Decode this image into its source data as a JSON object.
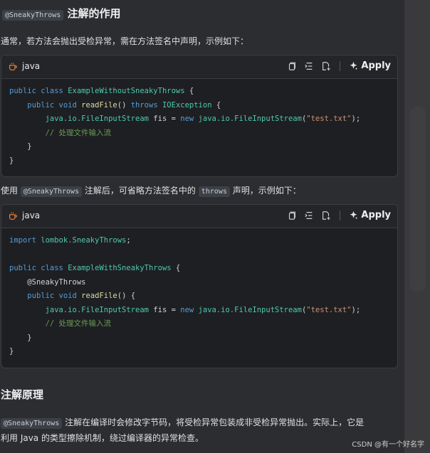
{
  "section1": {
    "badge": "@SneakyThrows",
    "title": "注解的作用",
    "intro": "通常，若方法会抛出受检异常，需在方法签名中声明，示例如下："
  },
  "codeblock1": {
    "lang": "java",
    "apply_label": "Apply",
    "lines": [
      [
        "public class ExampleWithoutSneakyThrows {"
      ],
      [
        "    public void readFile() throws IOException {"
      ],
      [
        "        java.io.FileInputStream fis = new java.io.FileInputStream(\"test.txt\");"
      ],
      [
        "        // 处理文件输入流"
      ],
      [
        "    }"
      ],
      [
        "}"
      ]
    ]
  },
  "mid": {
    "part1": "使用 ",
    "badge1": "@SneakyThrows",
    "part2": " 注解后，可省略方法签名中的 ",
    "badge2": "throws",
    "part3": " 声明，示例如下："
  },
  "codeblock2": {
    "lang": "java",
    "apply_label": "Apply"
  },
  "section2": {
    "title": "注解原理",
    "badge": "@SneakyThrows",
    "line1": " 注解在编译时会修改字节码，将受检异常包装成非受检异常抛出。实际上，它是",
    "line2": "利用 Java 的类型擦除机制，绕过编译器的异常检查。"
  },
  "watermark": "CSDN @有一个好名字",
  "icons": [
    "coffee-icon",
    "copy-icon",
    "insert-icon",
    "new-file-icon",
    "sparkle-icon"
  ]
}
